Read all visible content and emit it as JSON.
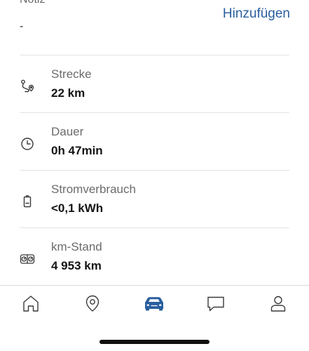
{
  "note": {
    "label": "Notiz",
    "value": "-",
    "add_label": "Hinzufügen"
  },
  "details": [
    {
      "icon": "route-icon",
      "label": "Strecke",
      "value": "22 km"
    },
    {
      "icon": "clock-icon",
      "label": "Dauer",
      "value": "0h 47min"
    },
    {
      "icon": "battery-icon",
      "label": "Stromverbrauch",
      "value": "<0,1 kWh"
    },
    {
      "icon": "odometer-icon",
      "label": "km-Stand",
      "value": "4 953 km"
    }
  ],
  "tabbar": {
    "items": [
      {
        "icon": "home-icon",
        "active": false
      },
      {
        "icon": "map-pin-icon",
        "active": false
      },
      {
        "icon": "car-icon",
        "active": true
      },
      {
        "icon": "chat-icon",
        "active": false
      },
      {
        "icon": "profile-icon",
        "active": false
      }
    ]
  },
  "colors": {
    "accent": "#2a5f9e",
    "text_primary": "#141414",
    "text_secondary": "#6b6b6b",
    "icon": "#3a3a3a",
    "divider": "#e4e4e4"
  }
}
